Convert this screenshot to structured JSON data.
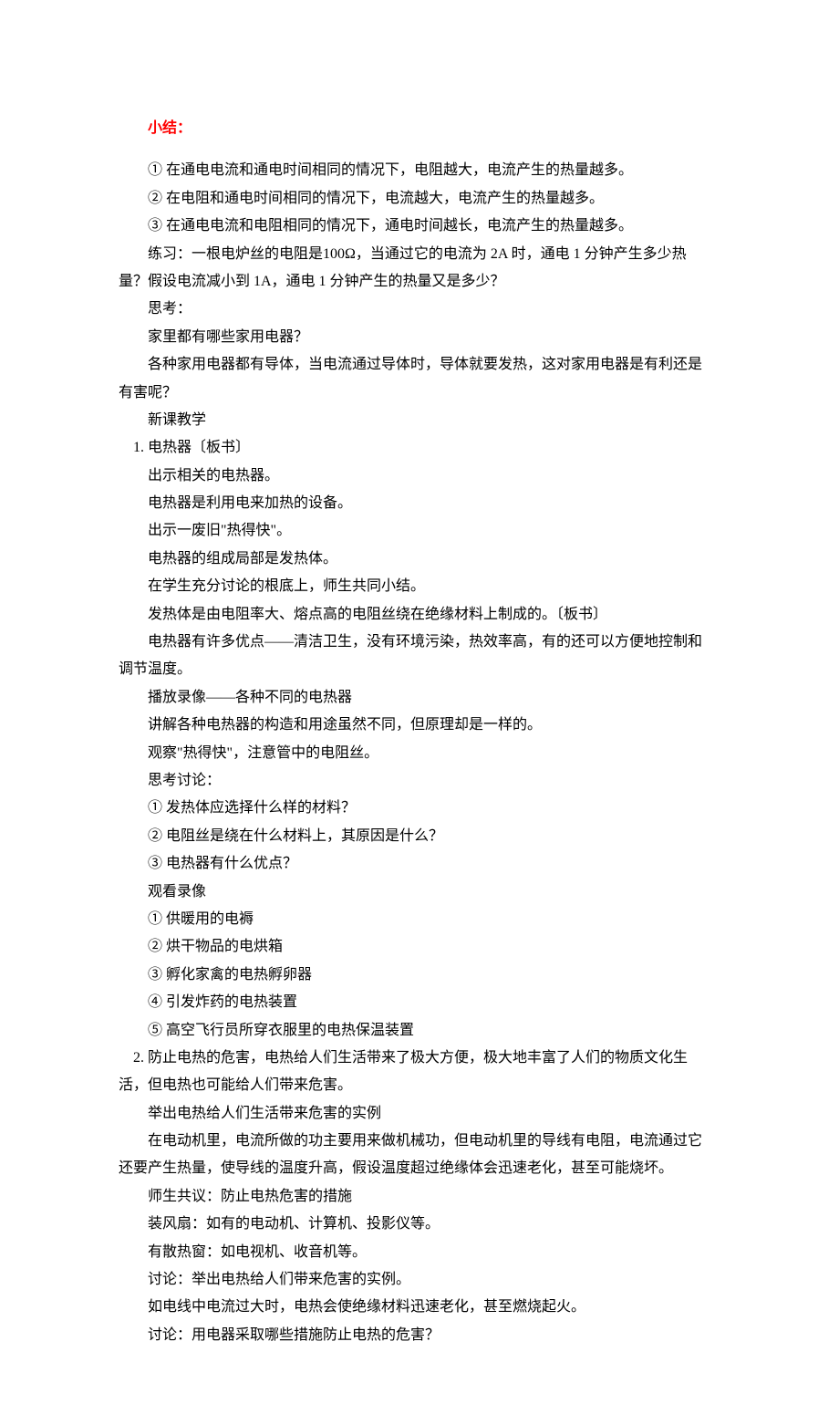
{
  "summary_title": "小结：",
  "summary_items": [
    "① 在通电电流和通电时间相同的情况下，电阻越大，电流产生的热量越多。",
    "② 在电阻和通电时间相同的情况下，电流越大，电流产生的热量越多。",
    "③ 在通电电流和电阻相同的情况下，通电时间越长，电流产生的热量越多。"
  ],
  "exercise1": "练习：一根电炉丝的电阻是100Ω，当通过它的电流为 2A 时，通电 1 分钟产生多少热",
  "exercise2": "量？假设电流减小到 1A，通电 1 分钟产生的热量又是多少？",
  "think_label": "思考：",
  "think_q1": "家里都有哪些家用电器？",
  "think_q2a": "各种家用电器都有导体，当电流通过导体时，导体就要发热，这对家用电器是有利还是",
  "think_q2b": "有害呢？",
  "new_class": "新课教学",
  "heater_title": "1. 电热器〔板书〕",
  "heater_lines": [
    "出示相关的电热器。",
    "电热器是利用电来加热的设备。",
    "出示一废旧\"热得快\"。",
    "电热器的组成局部是发热体。",
    "在学生充分讨论的根底上，师生共同小结。",
    "发热体是由电阻率大、熔点高的电阻丝绕在绝缘材料上制成的。〔板书〕"
  ],
  "heater_adv1": "电热器有许多优点——清洁卫生，没有环境污染，热效率高，有的还可以方便地控制和",
  "heater_adv2": "调节温度。",
  "video_line": "播放录像——各种不同的电热器",
  "explain_line": "讲解各种电热器的构造和用途虽然不同，但原理却是一样的。",
  "observe_line": "观察\"热得快\"，注意管中的电阻丝。",
  "discuss_label": "思考讨论：",
  "discuss_items": [
    "① 发热体应选择什么样的材料？",
    "② 电阻丝是绕在什么材料上，其原因是什么？",
    "③ 电热器有什么优点？"
  ],
  "watch_label": "观看录像",
  "watch_items": [
    "① 供暖用的电褥",
    "② 烘干物品的电烘箱",
    "③ 孵化家禽的电热孵卵器",
    "④ 引发炸药的电热装置",
    "⑤ 高空飞行员所穿衣服里的电热保温装置"
  ],
  "prevent_title1": "2. 防止电热的危害，电热给人们生活带来了极大方便，极大地丰富了人们的物质文化生",
  "prevent_title2": "活，但电热也可能给人们带来危害。",
  "prevent_lines": [
    "举出电热给人们生活带来危害的实例",
    "在电动机里，电流所做的功主要用来做机械功，但电动机里的导线有电阻，电流通过它"
  ],
  "prevent_cont": "还要产生热量，使导线的温度升高，假设温度超过绝缘体会迅速老化，甚至可能烧坏。",
  "prevent_more": [
    "师生共议：防止电热危害的措施",
    "装风扇：如有的电动机、计算机、投影仪等。",
    "有散热窗：如电视机、收音机等。",
    "讨论：举出电热给人们带来危害的实例。",
    "如电线中电流过大时，电热会使绝缘材料迅速老化，甚至燃烧起火。",
    "讨论：用电器采取哪些措施防止电热的危害？"
  ]
}
